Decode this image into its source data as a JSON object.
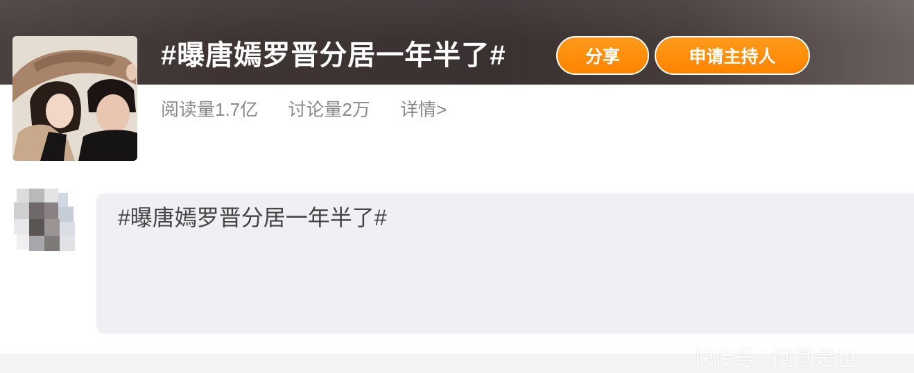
{
  "topic": {
    "title": "#曝唐嫣罗晋分居一年半了#",
    "share_label": "分享",
    "host_label": "申请主持人",
    "stats": {
      "reads": "阅读量1.7亿",
      "discussions": "讨论量2万",
      "details": "详情>"
    }
  },
  "post": {
    "text": "#曝唐嫣罗晋分居一年半了#"
  },
  "watermark": "快传号 / 阿圆是也",
  "colors": {
    "accent_orange": "#ff8a00",
    "header_dark": "#3e3434",
    "bubble_bg": "#eef0f4",
    "stats_text": "#8a8a8a"
  },
  "icons": {
    "cover": "couple-photo",
    "avatar": "pixelated-avatar"
  }
}
